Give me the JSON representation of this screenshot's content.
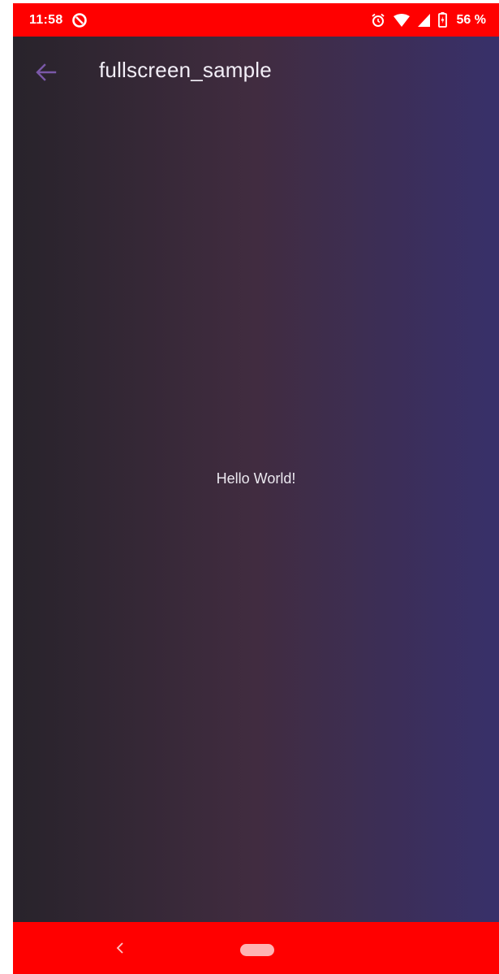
{
  "colors": {
    "status_bar": "#ff0000",
    "nav_bar": "#ff0000",
    "gradient_start": "#28232b",
    "gradient_mid": "#412c40",
    "gradient_end": "#38306a",
    "back_arrow": "#7a58a8",
    "nav_home_pill": "#ffb3b3",
    "nav_back_chevron": "#ffc6c6"
  },
  "status_bar": {
    "time": "11:58",
    "left_icons": [
      "data-saver-icon"
    ],
    "right_icons": [
      "alarm-icon",
      "wifi-icon",
      "cellular-signal-icon",
      "battery-charging-icon"
    ],
    "battery_percent": "56 %"
  },
  "app_bar": {
    "back_icon": "arrow-back-icon",
    "title": "fullscreen_sample"
  },
  "main": {
    "message": "Hello World!"
  },
  "navigation_bar": {
    "buttons": [
      "back-chevron-icon",
      "home-pill"
    ]
  }
}
